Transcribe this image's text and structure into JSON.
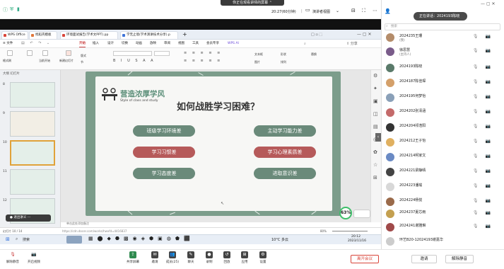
{
  "topbar": {
    "share_banner": "你正在观看讲师的屏幕",
    "timer": "20:27(60分钟)",
    "view_mode": "演讲者视图",
    "speaking": "正在讲话：2024193陈晓"
  },
  "wps": {
    "tabs": [
      {
        "label": "WPS Office",
        "color": "#d9453a"
      },
      {
        "label": "找稻壳模板",
        "color": "#e0763a"
      },
      {
        "label": "环境面试报告(学术文PPT).pp",
        "color": "#d9453a"
      },
      {
        "label": "学无止境(学术演讲技术分享).p",
        "color": "#3f74d9"
      }
    ],
    "tab_add": "+",
    "right_label": "WPS AI",
    "menu": [
      "≡ 文件",
      "开始",
      "插入",
      "设计",
      "切换",
      "动画",
      "放映",
      "审阅",
      "视图",
      "工具",
      "会员专享",
      "WPS AI"
    ],
    "ribbon": {
      "paste": "格式刷",
      "new_slide": "新建幻灯片",
      "layout": "版式",
      "section": "节",
      "textbox": "文本框",
      "shape": "形状",
      "arrange": "排列",
      "picture": "图片",
      "replace": "替换",
      "from_current": "当前开始"
    }
  },
  "slide": {
    "brand_title": "营造浓厚学风",
    "brand_sub": "Style of class and study",
    "main_title": "如何战胜学习困难？",
    "items": [
      {
        "label": "班级学习环境差",
        "color": "green"
      },
      {
        "label": "主动学习能力差",
        "color": "green"
      },
      {
        "label": "学习习惯差",
        "color": "red"
      },
      {
        "label": "学习心理素质差",
        "color": "red"
      },
      {
        "label": "学习态度差",
        "color": "green"
      },
      {
        "label": "进取意识差",
        "color": "green"
      }
    ],
    "badge": "63%",
    "thumb_numbers": [
      "8",
      "9",
      "10",
      "11",
      "12"
    ],
    "notes_label": "单击此处添加备注"
  },
  "status": {
    "slide_count": "幻灯片 10 / 14",
    "url": "https://cdn.docer.com/works/hwxfd=4416837",
    "zoom": "80%"
  },
  "taskbar": {
    "search": "搜索",
    "weather": "10°C 多云",
    "time": "20:12",
    "date": "2023/11/16"
  },
  "meeting_bar": {
    "left": [
      {
        "label": "解除静音",
        "icon": "mic-icon"
      },
      {
        "label": "开启视频",
        "icon": "camera-icon"
      }
    ],
    "center": [
      {
        "label": "共享屏幕",
        "icon": "share-icon"
      },
      {
        "label": "邀请",
        "icon": "invite-icon"
      },
      {
        "label": "成员(25)",
        "icon": "members-icon"
      },
      {
        "label": "聊天",
        "icon": "chat-icon"
      },
      {
        "label": "录制",
        "icon": "record-icon"
      },
      {
        "label": "回放",
        "icon": "playback-icon"
      },
      {
        "label": "应用",
        "icon": "apps-icon"
      },
      {
        "label": "设置",
        "icon": "settings-icon"
      }
    ],
    "leave": "离开会议"
  },
  "participants": {
    "search_placeholder": "搜索",
    "list": [
      {
        "name": "2024235王珊",
        "role": "(我)",
        "avatar_color": "#b48c6a"
      },
      {
        "name": "徐思慧",
        "role": "(主持人)",
        "avatar_color": "#7a5c8a"
      },
      {
        "name": "2024193陈晓",
        "role": "",
        "avatar_color": "#5a7a6a"
      },
      {
        "name": "2024187陈佳琛",
        "role": "",
        "avatar_color": "#d4a06a"
      },
      {
        "name": "2024195何梦怡",
        "role": "",
        "avatar_color": "#8aa0b8"
      },
      {
        "name": "2024202张清涵",
        "role": "",
        "avatar_color": "#c46a6a"
      },
      {
        "name": "2024204祁浩阳",
        "role": "",
        "avatar_color": "#333333"
      },
      {
        "name": "2024212王子怡",
        "role": "",
        "avatar_color": "#e0b060"
      },
      {
        "name": "2024214柯家文",
        "role": "",
        "avatar_color": "#6a8ac4"
      },
      {
        "name": "2024221梁静晴",
        "role": "",
        "avatar_color": "#444444"
      },
      {
        "name": "2024223潘瑜",
        "role": "",
        "avatar_color": "#d8d8d8"
      },
      {
        "name": "2024224杨悦",
        "role": "",
        "avatar_color": "#9a6a4a"
      },
      {
        "name": "2024237夏芯雨",
        "role": "",
        "avatar_color": "#c4a050"
      },
      {
        "name": "2024241谢雅琳",
        "role": "",
        "avatar_color": "#a04a4a"
      },
      {
        "name": "环艺B20-12024193谢嘉华",
        "role": "",
        "avatar_color": "#cccccc"
      }
    ],
    "invite_button": "邀请",
    "mute_all_button": "解除静音"
  }
}
